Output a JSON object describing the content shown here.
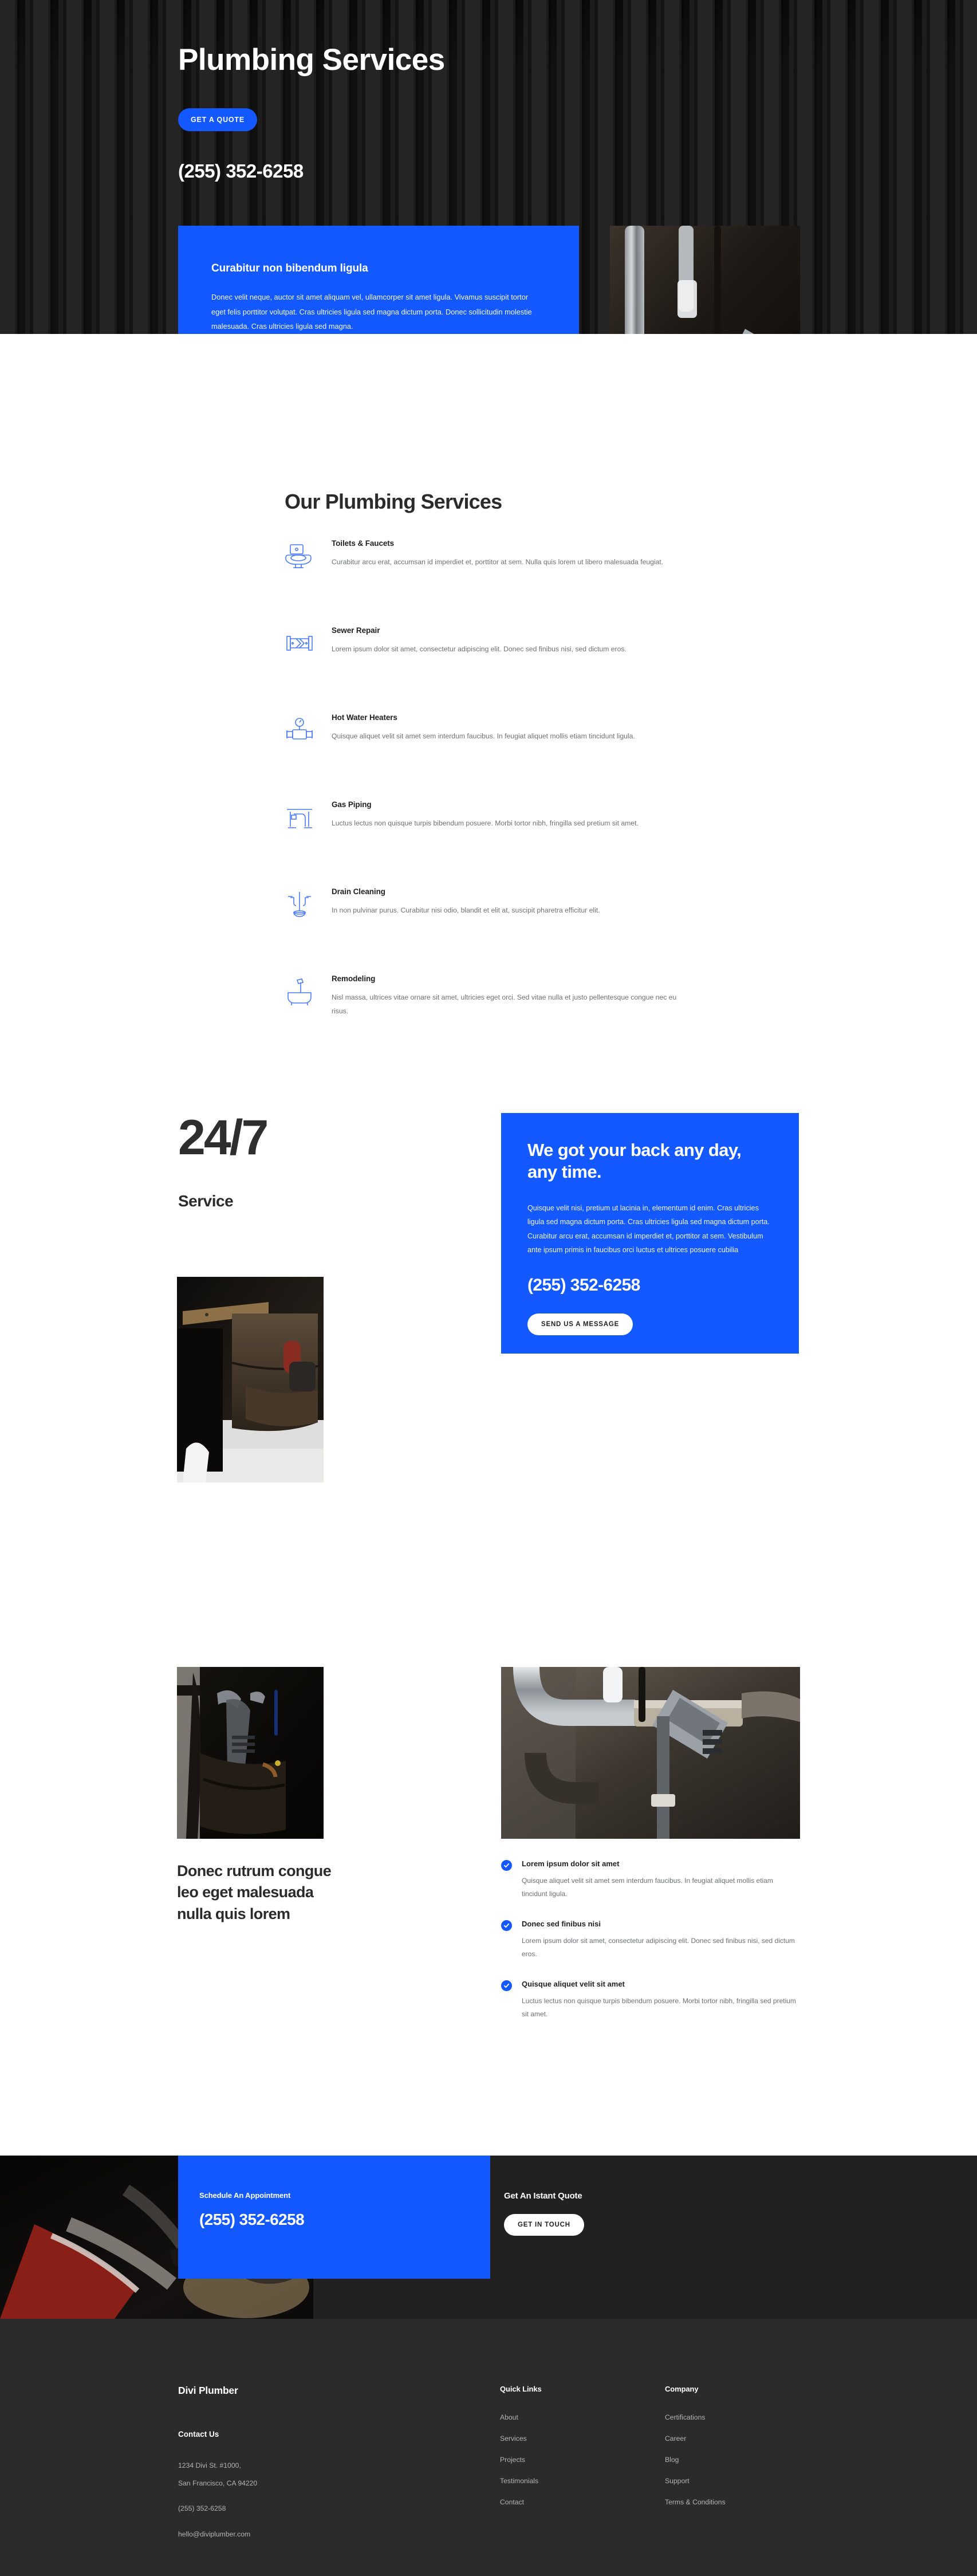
{
  "colors": {
    "accent": "#1459ff",
    "dark": "#212121",
    "footer": "#2b2b2b",
    "body_text": "#6f7072"
  },
  "hero": {
    "title": "Plumbing Services",
    "quote_button": "GET A QUOTE",
    "phone": "(255) 352-6258",
    "card": {
      "heading": "Curabitur non bibendum ligula",
      "body": "Donec velit neque, auctor sit amet aliquam vel, ullamcorper sit amet ligula. Vivamus suscipit tortor eget felis porttitor volutpat. Cras ultricies ligula sed magna dictum porta. Donec sollicitudin molestie malesuada. Cras ultricies ligula sed magna."
    },
    "image_alt": "chrome-pipes-wrench-photo"
  },
  "services": {
    "heading": "Our Plumbing Services",
    "items": [
      {
        "icon": "toilet-icon",
        "title": "Toilets & Faucets",
        "desc": "Curabitur arcu erat, accumsan id imperdiet et, porttitor at sem. Nulla quis lorem ut libero malesuada feugiat."
      },
      {
        "icon": "sewer-pipe-icon",
        "title": "Sewer Repair",
        "desc": "Lorem ipsum dolor sit amet, consectetur adipiscing elit. Donec sed finibus nisi, sed dictum eros."
      },
      {
        "icon": "water-heater-gauge-icon",
        "title": "Hot Water Heaters",
        "desc": "Quisque aliquet velit sit amet sem interdum faucibus. In feugiat aliquet mollis etiam tincidunt ligula."
      },
      {
        "icon": "gas-pipe-icon",
        "title": "Gas Piping",
        "desc": "Luctus lectus non quisque turpis bibendum posuere. Morbi tortor nibh, fringilla sed pretium sit amet."
      },
      {
        "icon": "plunger-drain-icon",
        "title": "Drain Cleaning",
        "desc": "In non pulvinar purus. Curabitur nisi odio, blandit et elit at, suscipit pharetra efficitur elit."
      },
      {
        "icon": "bathtub-shower-icon",
        "title": "Remodeling",
        "desc": "Nisl massa, ultrices vitae ornare sit amet, ultricies eget orci. Sed vitae nulla et justo pellentesque congue nec eu risus."
      }
    ]
  },
  "availability": {
    "big_number": "24/7",
    "subtitle": "Service",
    "worker_image_alt": "plumber-tool-belt-photo",
    "cta": {
      "heading": "We got your back any day, any time.",
      "body": "Quisque velit nisi, pretium ut lacinia in, elementum id enim. Cras ultricies ligula sed magna dictum porta. Cras ultricies ligula sed magna dictum porta. Curabitur arcu erat, accumsan id imperdiet et, porttitor at sem. Vestibulum ante ipsum primis in faucibus orci luctus et ultrices posuere cubilia",
      "phone": "(255) 352-6258",
      "button": "SEND US A MESSAGE"
    }
  },
  "features": {
    "left_image_alt": "wrench-in-tool-pouch-photo",
    "right_image_alt": "chrome-pipe-wrench-photo",
    "heading": "Donec rutrum congue leo eget malesuada nulla quis lorem",
    "items": [
      {
        "title": "Lorem ipsum dolor sit amet",
        "desc": "Quisque aliquet velit sit amet sem interdum faucibus. In feugiat aliquet mollis etiam tincidunt ligula."
      },
      {
        "title": "Donec sed finibus nisi",
        "desc": "Lorem ipsum dolor sit amet, consectetur adipiscing elit. Donec sed finibus nisi, sed dictum eros."
      },
      {
        "title": "Quisque aliquet velit sit amet",
        "desc": "Luctus lectus non quisque turpis bibendum posuere. Morbi tortor nibh, fringilla sed pretium sit amet."
      }
    ]
  },
  "banner": {
    "image_alt": "plumber-hands-wrench-photo",
    "schedule_label": "Schedule An Appointment",
    "schedule_phone": "(255) 352-6258",
    "quote_label": "Get An Istant Quote",
    "quote_button": "GET IN TOUCH"
  },
  "footer": {
    "brand": "Divi Plumber",
    "contact_heading": "Contact Us",
    "address_line1": "1234 Divi St. #1000,",
    "address_line2": "San Francisco, CA 94220",
    "phone": "(255) 352-6258",
    "email": "hello@diviplumber.com",
    "quick_links_heading": "Quick Links",
    "quick_links": [
      "About",
      "Services",
      "Projects",
      "Testimonials",
      "Contact"
    ],
    "company_heading": "Company",
    "company_links": [
      "Certifications",
      "Career",
      "Blog",
      "Support",
      "Terms & Conditions"
    ]
  }
}
